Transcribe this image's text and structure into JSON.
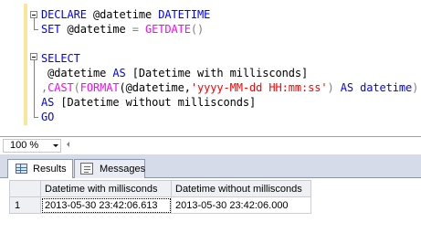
{
  "editor": {
    "lines": [
      {
        "keyword": "DECLARE",
        "rest": " @datetime ",
        "type": "DATETIME"
      },
      {
        "keyword": "SET",
        "rest": " @datetime ",
        "op": "=",
        "fn": "GETDATE",
        "paren": "()"
      },
      {
        "keyword": "SELECT"
      },
      {
        "indent": " @datetime ",
        "kw_as": "AS",
        "alias": " [Datetime with millisconds]"
      },
      {
        "comma": ",",
        "fn_cast": "CAST",
        "paren_open": "(",
        "fn_format": "FORMAT",
        "arg": "(@datetime,",
        "str": "'yyyy-MM-dd HH:mm:ss'",
        "tail_paren": ") ",
        "kw_as": "AS",
        "type": " datetime",
        "close": ")"
      },
      {
        "kw_as": "AS",
        "alias": " [Datetime without millisconds]"
      },
      {
        "keyword": "GO"
      }
    ]
  },
  "zoom": {
    "value": "100 %"
  },
  "tabs": {
    "results_label": "Results",
    "messages_label": "Messages"
  },
  "grid": {
    "columns": [
      "Datetime with millisconds",
      "Datetime without millisconds"
    ],
    "rows": [
      {
        "num": "1",
        "cells": [
          "2013-05-30 23:42:06.613",
          "2013-05-30 23:42:06.000"
        ]
      }
    ]
  },
  "colors": {
    "keyword": "#0000ff",
    "function": "#ff00ff",
    "string": "#ff0000",
    "operator": "#808080",
    "change_bar": "#fae69b",
    "tab_strip": "#d6dbe9"
  }
}
